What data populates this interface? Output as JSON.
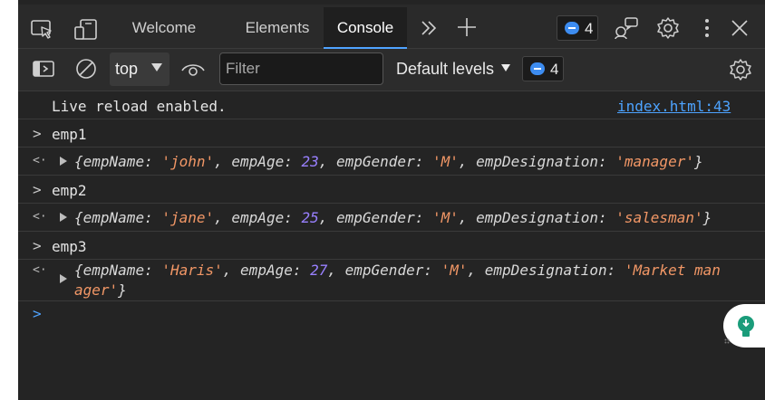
{
  "tabbar": {
    "tabs": [
      {
        "label": "Welcome",
        "active": false
      },
      {
        "label": "Elements",
        "active": false
      },
      {
        "label": "Console",
        "active": true
      }
    ],
    "issues_count": "4"
  },
  "toolbar": {
    "context": "top",
    "filter_placeholder": "Filter",
    "levels_label": "Default levels",
    "issues_count": "4"
  },
  "console": {
    "log": {
      "text": "Live reload enabled.",
      "source": "index.html:43"
    },
    "entries": [
      {
        "input": "emp1",
        "fields": [
          {
            "key": "empName",
            "value": "'john'",
            "type": "string"
          },
          {
            "key": "empAge",
            "value": "23",
            "type": "number"
          },
          {
            "key": "empGender",
            "value": "'M'",
            "type": "string"
          },
          {
            "key": "empDesignation",
            "value": "'manager'",
            "type": "string"
          }
        ]
      },
      {
        "input": "emp2",
        "fields": [
          {
            "key": "empName",
            "value": "'jane'",
            "type": "string"
          },
          {
            "key": "empAge",
            "value": "25",
            "type": "number"
          },
          {
            "key": "empGender",
            "value": "'M'",
            "type": "string"
          },
          {
            "key": "empDesignation",
            "value": "'salesman'",
            "type": "string"
          }
        ]
      },
      {
        "input": "emp3",
        "fields": [
          {
            "key": "empName",
            "value": "'Haris'",
            "type": "string"
          },
          {
            "key": "empAge",
            "value": "27",
            "type": "number"
          },
          {
            "key": "empGender",
            "value": "'M'",
            "type": "string"
          },
          {
            "key": "empDesignation",
            "value": "'Market manager'",
            "type": "string"
          }
        ],
        "wrap_line1": "'Market man",
        "wrap_line2": "ager'"
      }
    ]
  },
  "colors": {
    "accent": "#4fa3ff",
    "string": "#f29766",
    "number": "#9980ff",
    "background": "#242424",
    "lightbulb": "#1a9c7a"
  }
}
